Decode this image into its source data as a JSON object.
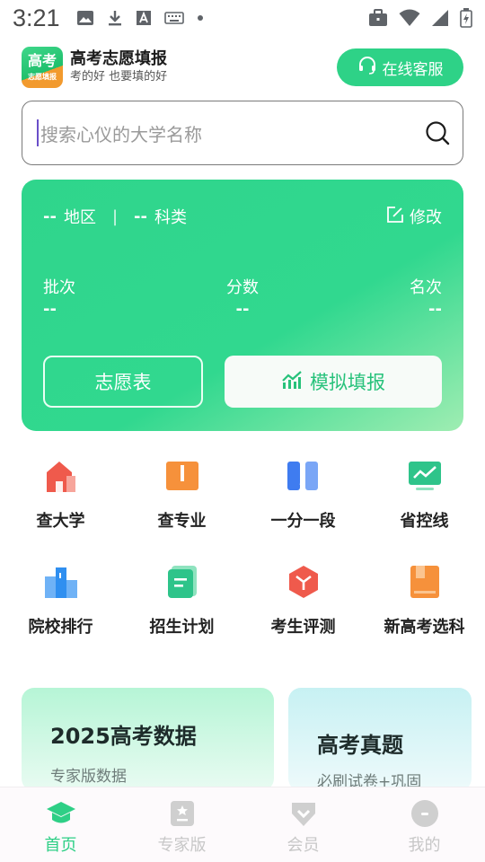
{
  "status_bar": {
    "time": "3:21",
    "icons": [
      "image-icon",
      "download-icon",
      "a-box-icon",
      "keyboard-icon",
      "dot-icon",
      "briefcase-icon",
      "wifi-icon",
      "signal-icon",
      "battery-icon"
    ]
  },
  "header": {
    "logo_main": "高考",
    "logo_sub": "志愿填报",
    "app_name": "高考志愿填报",
    "slogan": "考的好 也要填的好",
    "service_button": "在线客服"
  },
  "search": {
    "placeholder": "搜索心仪的大学名称"
  },
  "score_card": {
    "region_value": "--",
    "region_label": "地区",
    "subject_value": "--",
    "subject_label": "科类",
    "separator": "|",
    "edit_label": "修改",
    "stats": [
      {
        "label": "批次",
        "value": "--"
      },
      {
        "label": "分数",
        "value": "--"
      },
      {
        "label": "名次",
        "value": "--"
      }
    ],
    "volunteer_button": "志愿表",
    "simulate_button": "模拟填报"
  },
  "features": [
    {
      "label": "查大学",
      "icon": "university-icon",
      "color": "#ef5a4c"
    },
    {
      "label": "查专业",
      "icon": "book-icon",
      "color": "#f6913b"
    },
    {
      "label": "一分一段",
      "icon": "score-segment-icon",
      "color": "#3f7cf0"
    },
    {
      "label": "省控线",
      "icon": "trend-monitor-icon",
      "color": "#2ec48a"
    },
    {
      "label": "院校排行",
      "icon": "ranking-icon",
      "color": "#2f8ff0"
    },
    {
      "label": "招生计划",
      "icon": "plan-document-icon",
      "color": "#2ec48a"
    },
    {
      "label": "考生评测",
      "icon": "assessment-cube-icon",
      "color": "#ef5a4c"
    },
    {
      "label": "新高考选科",
      "icon": "subject-select-icon",
      "color": "#f6913b"
    }
  ],
  "promos": [
    {
      "title": "2025高考数据",
      "subtitle": "专家版数据"
    },
    {
      "title": "高考真题",
      "subtitle": "必刷试卷+巩固"
    }
  ],
  "bottom_nav": [
    {
      "label": "首页",
      "icon": "home-cap-icon",
      "active": true
    },
    {
      "label": "专家版",
      "icon": "expert-doc-icon",
      "active": false
    },
    {
      "label": "会员",
      "icon": "vip-shield-icon",
      "active": false
    },
    {
      "label": "我的",
      "icon": "profile-icon",
      "active": false
    }
  ],
  "colors": {
    "brand_green": "#2ed287",
    "card_gradient_end": "#9fedb2",
    "nav_active": "#2ecf86",
    "nav_inactive": "#c7c7c7"
  }
}
